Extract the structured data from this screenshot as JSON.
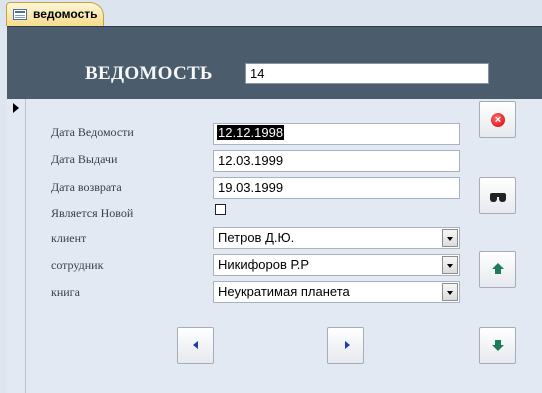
{
  "tab": {
    "title": "ведомость",
    "icon": "form-icon"
  },
  "header": {
    "title": "ВЕДОМОСТЬ",
    "record_id": "14"
  },
  "fields": {
    "statement_date": {
      "label": "Дата Ведомости",
      "value": "12.12.1998"
    },
    "issue_date": {
      "label": "Дата Выдачи",
      "value": "12.03.1999"
    },
    "return_date": {
      "label": "Дата возврата",
      "value": "19.03.1999"
    },
    "is_new": {
      "label": "Является Новой",
      "checked": false
    },
    "client": {
      "label": "клиент",
      "value": "Петров Д.Ю."
    },
    "employee": {
      "label": "сотрудник",
      "value": "Никифоров Р.Р"
    },
    "book": {
      "label": "книга",
      "value": "Неукратимая планета"
    }
  },
  "buttons": {
    "close": {
      "icon": "close-icon",
      "glyph": "×"
    },
    "find": {
      "icon": "binoculars-icon"
    },
    "move_up": {
      "icon": "arrow-up-icon"
    },
    "move_down": {
      "icon": "arrow-down-icon"
    },
    "prev_record": {
      "icon": "arrow-left-icon"
    },
    "next_record": {
      "icon": "arrow-right-icon"
    }
  }
}
